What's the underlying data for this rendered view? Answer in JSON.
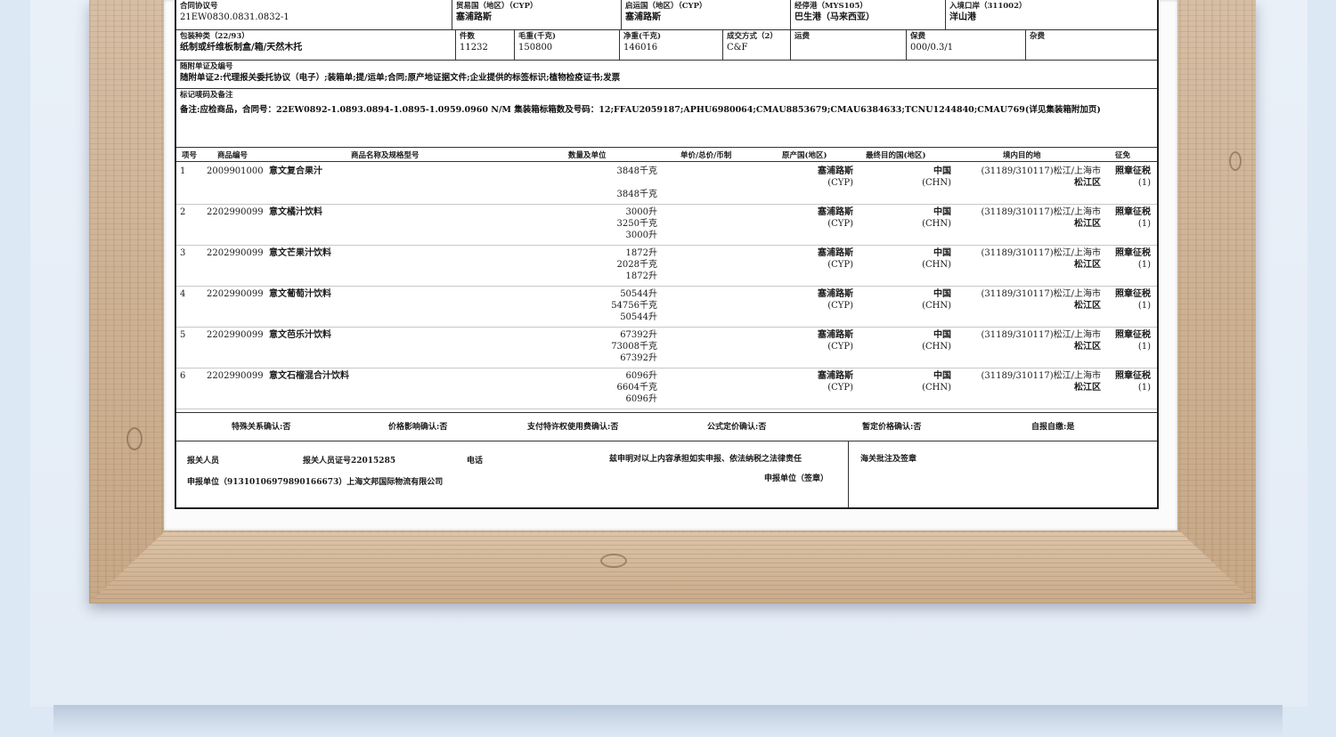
{
  "header": {
    "contract_no": {
      "label": "合同协议号",
      "value": "21EW0830.0831.0832-1"
    },
    "trade_country": {
      "label": "贸易国（地区）（CYP）",
      "value": "塞浦路斯"
    },
    "origin_country": {
      "label": "启运国（地区）（CYP）",
      "value": "塞浦路斯"
    },
    "transit_port": {
      "label": "经停港（MYS105）",
      "value": "巴生港（马来西亚）"
    },
    "entry_port": {
      "label": "入境口岸（311002）",
      "value": "洋山港"
    },
    "package_type": {
      "label": "包装种类（22/93）",
      "value": "纸制或纤维板制盒/箱/天然木托"
    },
    "pieces": {
      "label": "件数",
      "value": "11232"
    },
    "gross_weight": {
      "label": "毛重(千克)",
      "value": "150800"
    },
    "net_weight": {
      "label": "净重(千克)",
      "value": "146016"
    },
    "transaction_mode": {
      "label": "成交方式（2）",
      "value": "C&F"
    },
    "freight": {
      "label": "运费",
      "value": ""
    },
    "insurance": {
      "label": "保费",
      "value": "000/0.3/1"
    },
    "misc": {
      "label": "杂费",
      "value": ""
    }
  },
  "attached_docs": {
    "label": "随附单证及编号",
    "value": "随附单证2:代理报关委托协议（电子）;装箱单;提/运单;合同;原产地证据文件;企业提供的标签标识;植物检疫证书;发票"
  },
  "marks": {
    "label": "标记唛码及备注",
    "value": "备注:应检商品，合同号：22EW0892-1.0893.0894-1.0895-1.0959.0960 N/M  集装箱标箱数及号码：12;FFAU2059187;APHU6980064;CMAU8853679;CMAU6384633;TCNU1244840;CMAU769(详见集装箱附加页)"
  },
  "columns": [
    "项号",
    "商品编号",
    "商品名称及规格型号",
    "数量及单位",
    "单价/总价/币制",
    "原产国(地区)",
    "最终目的国(地区)",
    "境内目的地",
    "征免"
  ],
  "items": [
    {
      "no": "1",
      "code": "2009901000",
      "name": "意文复合果汁",
      "qty": [
        "3848千克",
        "",
        "3848千克"
      ],
      "origin": [
        "塞浦路斯",
        "(CYP)"
      ],
      "dest": [
        "中国",
        "(CHN)"
      ],
      "domestic": [
        "(31189/310117)松江/上海市",
        "松江区"
      ],
      "tax": [
        "照章征税",
        "(1)"
      ]
    },
    {
      "no": "2",
      "code": "2202990099",
      "name": "意文橘汁饮料",
      "qty": [
        "3000升",
        "3250千克",
        "3000升"
      ],
      "origin": [
        "塞浦路斯",
        "(CYP)"
      ],
      "dest": [
        "中国",
        "(CHN)"
      ],
      "domestic": [
        "(31189/310117)松江/上海市",
        "松江区"
      ],
      "tax": [
        "照章征税",
        "(1)"
      ]
    },
    {
      "no": "3",
      "code": "2202990099",
      "name": "意文芒果汁饮料",
      "qty": [
        "1872升",
        "2028千克",
        "1872升"
      ],
      "origin": [
        "塞浦路斯",
        "(CYP)"
      ],
      "dest": [
        "中国",
        "(CHN)"
      ],
      "domestic": [
        "(31189/310117)松江/上海市",
        "松江区"
      ],
      "tax": [
        "照章征税",
        "(1)"
      ]
    },
    {
      "no": "4",
      "code": "2202990099",
      "name": "意文葡萄汁饮料",
      "qty": [
        "50544升",
        "54756千克",
        "50544升"
      ],
      "origin": [
        "塞浦路斯",
        "(CYP)"
      ],
      "dest": [
        "中国",
        "(CHN)"
      ],
      "domestic": [
        "(31189/310117)松江/上海市",
        "松江区"
      ],
      "tax": [
        "照章征税",
        "(1)"
      ]
    },
    {
      "no": "5",
      "code": "2202990099",
      "name": "意文芭乐汁饮料",
      "qty": [
        "67392升",
        "73008千克",
        "67392升"
      ],
      "origin": [
        "塞浦路斯",
        "(CYP)"
      ],
      "dest": [
        "中国",
        "(CHN)"
      ],
      "domestic": [
        "(31189/310117)松江/上海市",
        "松江区"
      ],
      "tax": [
        "照章征税",
        "(1)"
      ]
    },
    {
      "no": "6",
      "code": "2202990099",
      "name": "意文石榴混合汁饮料",
      "qty": [
        "6096升",
        "6604千克",
        "6096升"
      ],
      "origin": [
        "塞浦路斯",
        "(CYP)"
      ],
      "dest": [
        "中国",
        "(CHN)"
      ],
      "domestic": [
        "(31189/310117)松江/上海市",
        "松江区"
      ],
      "tax": [
        "照章征税",
        "(1)"
      ]
    }
  ],
  "confirmations": [
    "特殊关系确认:否",
    "价格影响确认:否",
    "支付特许权使用费确认:否",
    "公式定价确认:否",
    "暂定价格确认:否",
    "自报自缴:是"
  ],
  "footer": {
    "declarant": "报关人员",
    "declarant_id": "报关人员证号22015285",
    "phone": "电话",
    "statement": "兹申明对以上内容承担如实申报、依法纳税之法律责任",
    "applicant": "申报单位（91310106979890166673）上海文邦国际物流有限公司",
    "applicant_seal": "申报单位（签章）",
    "customs_note": "海关批注及签章"
  }
}
